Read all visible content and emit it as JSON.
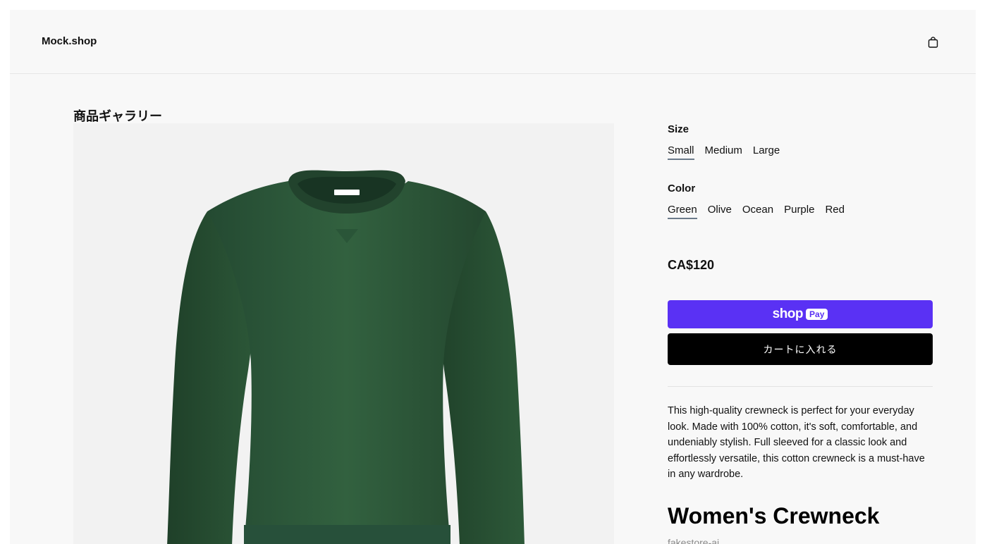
{
  "header": {
    "brand": "Mock.shop",
    "cart_icon": "shopping-bag-icon"
  },
  "gallery": {
    "title": "商品ギャラリー",
    "product_color": "#2f5b3e"
  },
  "options": {
    "size": {
      "label": "Size",
      "values": [
        "Small",
        "Medium",
        "Large"
      ],
      "selected": "Small"
    },
    "color": {
      "label": "Color",
      "values": [
        "Green",
        "Olive",
        "Ocean",
        "Purple",
        "Red"
      ],
      "selected": "Green"
    }
  },
  "price": "CA$120",
  "buttons": {
    "shop_pay_word": "shop",
    "shop_pay_pill": "Pay",
    "add_to_cart": "カートに入れる"
  },
  "description": "This high-quality crewneck is perfect for your everyday look. Made with 100% cotton, it's soft, comfortable, and undeniably stylish. Full sleeved for a classic look and effortlessly versatile, this cotton crewneck is a must-have in any wardrobe.",
  "product": {
    "title": "Women's Crewneck",
    "vendor": "fakestore-ai"
  },
  "colors": {
    "shop_pay": "#5a31f4",
    "add_to_cart_bg": "#000000",
    "page_bg": "#f8f8f8",
    "gallery_bg": "#f2f2f2"
  }
}
